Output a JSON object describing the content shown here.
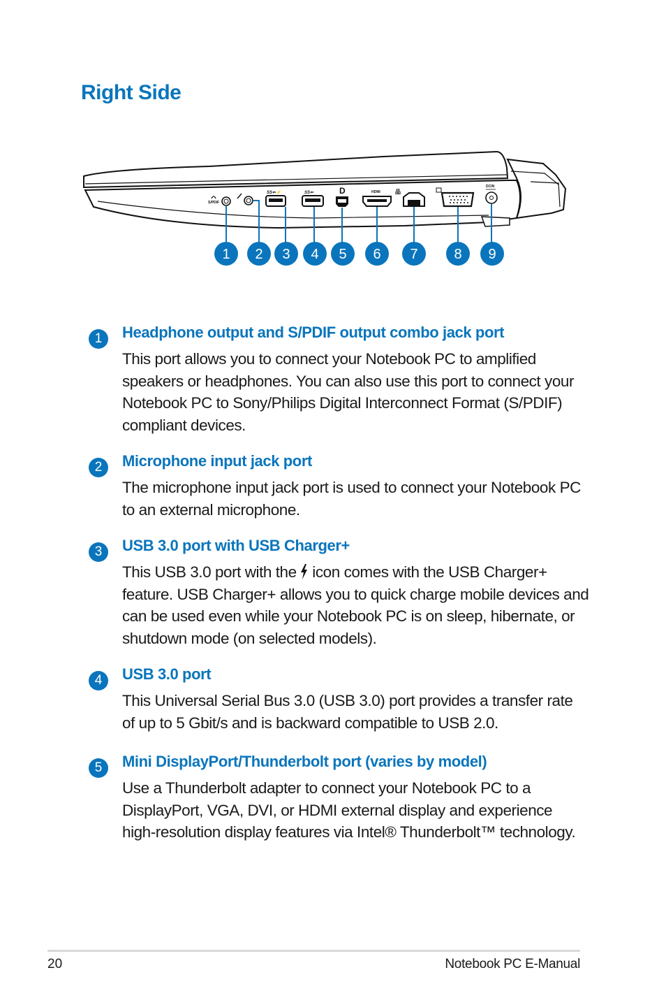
{
  "page": {
    "title": "Right Side",
    "accent_color": "#0a75bc"
  },
  "figure": {
    "description": "Right side view of notebook PC showing ports",
    "port_markings": {
      "spdif": "S/PDIF",
      "usb_charger": "SS⇐ ⚡",
      "usb": "SS⇐",
      "mini_dp": "D",
      "hdmi": "HDMI",
      "dcin": "DCIN"
    },
    "callouts": [
      "1",
      "2",
      "3",
      "4",
      "5",
      "6",
      "7",
      "8",
      "9"
    ]
  },
  "items": [
    {
      "number": "1",
      "heading": "Headphone output and S/PDIF output combo jack port",
      "body": "This port allows you to connect your Notebook PC to amplified speakers or headphones. You can also use this port to connect your Notebook PC to Sony/Philips Digital Interconnect Format (S/PDIF) compliant devices."
    },
    {
      "number": "2",
      "heading": "Microphone input jack port",
      "body": "The microphone input jack port is used to connect your Notebook PC to an external microphone."
    },
    {
      "number": "3",
      "heading": "USB 3.0 port with USB Charger+",
      "body_before_icon": "This USB 3.0 port with the",
      "body_icon": "lightning-bolt-icon",
      "body_after_icon": "icon comes with the USB Charger+ feature. USB Charger+ allows you to quick charge mobile devices and can be used even while your Notebook PC is on sleep, hibernate, or shutdown mode (on selected models)."
    },
    {
      "number": "4",
      "heading": "USB 3.0 port",
      "body": "This Universal Serial Bus 3.0 (USB 3.0) port provides a transfer rate of up to 5 Gbit/s and is backward compatible to USB 2.0."
    },
    {
      "number": "5",
      "heading": "Mini DisplayPort/Thunderbolt port (varies by model)",
      "body": "Use a Thunderbolt adapter to connect your Notebook PC to a DisplayPort, VGA, DVI, or HDMI external display and experience high-resolution display features via Intel® Thunderbolt™ technology."
    }
  ],
  "footer": {
    "page_number": "20",
    "manual_title": "Notebook PC E-Manual"
  }
}
